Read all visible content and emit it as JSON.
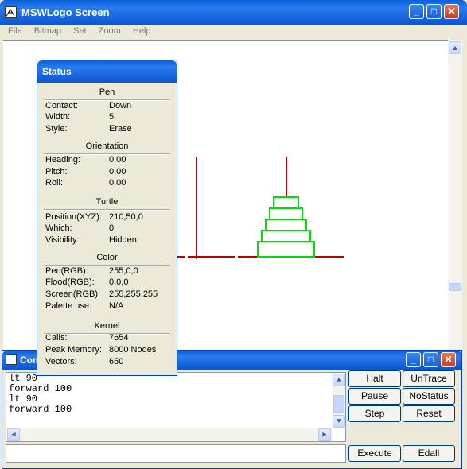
{
  "main_window": {
    "title": "MSWLogo Screen",
    "menu": [
      "File",
      "Bitmap",
      "Set",
      "Zoom",
      "Help"
    ]
  },
  "status": {
    "title": "Status",
    "pen": {
      "heading": "Pen",
      "rows": [
        [
          "Contact:",
          "Down"
        ],
        [
          "Width:",
          "5"
        ],
        [
          "Style:",
          "Erase"
        ]
      ]
    },
    "orientation": {
      "heading": "Orientation",
      "rows": [
        [
          "Heading:",
          "0.00"
        ],
        [
          "Pitch:",
          "0.00"
        ],
        [
          "Roll:",
          "0.00"
        ]
      ]
    },
    "turtle": {
      "heading": "Turtle",
      "rows": [
        [
          "Position(XYZ):",
          "210,50,0"
        ],
        [
          "Which:",
          "0"
        ],
        [
          "Visibility:",
          "Hidden"
        ]
      ]
    },
    "color": {
      "heading": "Color",
      "rows": [
        [
          "Pen(RGB):",
          "255,0,0"
        ],
        [
          "Flood(RGB):",
          "0,0,0"
        ],
        [
          "Screen(RGB):",
          "255,255,255"
        ],
        [
          "Palette use:",
          "N/A"
        ]
      ]
    },
    "kernel": {
      "heading": "Kernel",
      "rows": [
        [
          "Calls:",
          "7654"
        ],
        [
          "Peak Memory:",
          "8000 Nodes"
        ],
        [
          "Vectors:",
          "650"
        ]
      ]
    }
  },
  "commander": {
    "title": "Com",
    "history": [
      "lt 90",
      "forward 100",
      "lt 90",
      "forward 100"
    ],
    "input_value": "",
    "buttons": {
      "halt": "Halt",
      "untrace": "UnTrace",
      "pause": "Pause",
      "nostatus": "NoStatus",
      "step": "Step",
      "reset": "Reset",
      "execute": "Execute",
      "edall": "Edall"
    }
  },
  "colors": {
    "xp_blue": "#0a5fd8",
    "pen_red": "#c00000",
    "pen_green": "#00e000"
  }
}
